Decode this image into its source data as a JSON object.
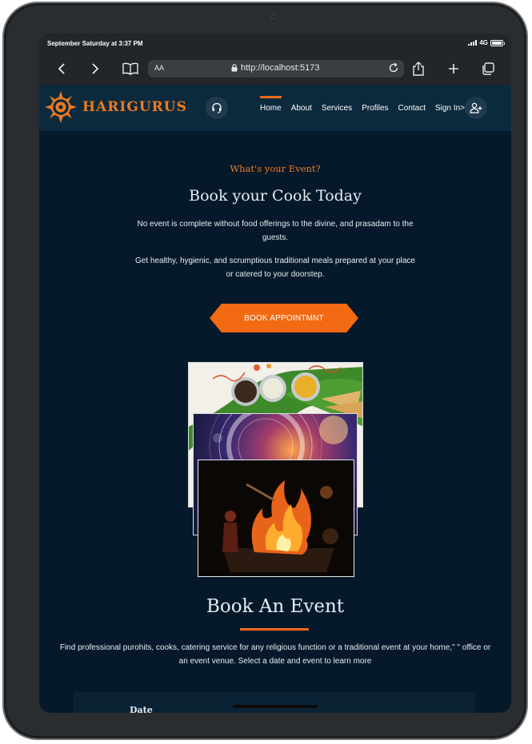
{
  "status_bar": {
    "time": "September Saturday at 3:37 PM",
    "network": "4G"
  },
  "browser": {
    "reader_label": "AA",
    "url": "http://localhost:5173",
    "icons": [
      "chevron-left-icon",
      "chevron-right-icon",
      "book-icon",
      "lock-icon",
      "reload-icon",
      "share-icon",
      "plus-icon",
      "tabs-icon"
    ]
  },
  "header": {
    "logo_text": "HARIGURUS",
    "nav": [
      {
        "label": "Home",
        "active": true
      },
      {
        "label": "About"
      },
      {
        "label": "Services"
      },
      {
        "label": "Profiles"
      },
      {
        "label": "Contact"
      },
      {
        "label": "Sign In>"
      }
    ],
    "support_icon": "headset-icon",
    "user_icon": "user-add-icon"
  },
  "hero": {
    "eyebrow": "What's your Event?",
    "title": "Book your Cook Today",
    "paragraph1": "No event is complete without food offerings to the divine, and prasadam to the guests.",
    "paragraph2": "Get healthy, hygienic, and scrumptious traditional meals prepared at your place or catered to your doorstep.",
    "cta": "BOOK APPOINTMNT"
  },
  "event_section": {
    "title": "Book An Event",
    "description": "Find professional purohits, cooks, catering service for any religious function or a traditional event at your home,\" \" office or an event venue. Select a date and event to learn more",
    "date_label": "Date"
  },
  "colors": {
    "accent": "#f26a12",
    "background": "#06192a",
    "header": "#0c2a3e"
  }
}
